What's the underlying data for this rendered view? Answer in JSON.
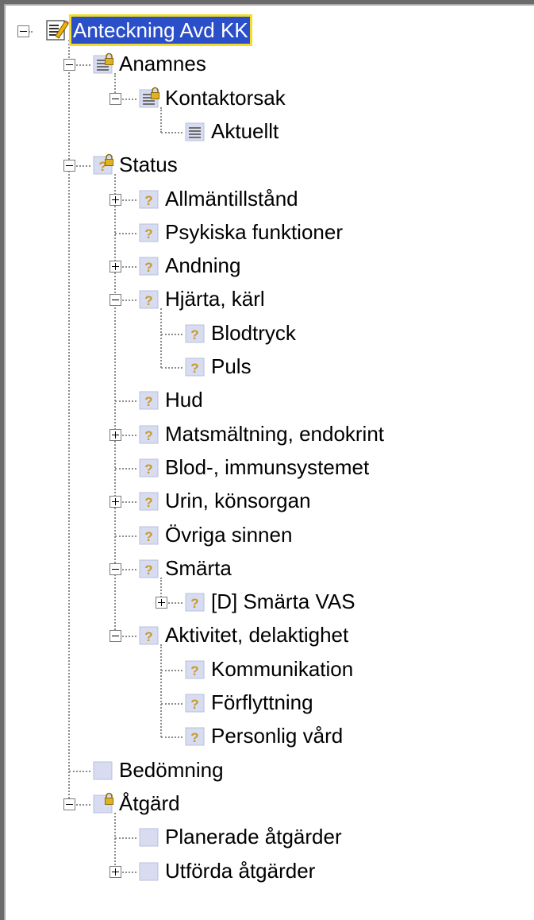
{
  "tree": {
    "nodes": [
      {
        "label": "Anteckning Avd KK",
        "icon": "note-pencil-icon",
        "depth": 0,
        "toggle": "minus",
        "selected": true
      },
      {
        "label": "Anamnes",
        "icon": "locked-document-icon",
        "depth": 1,
        "toggle": "minus"
      },
      {
        "label": "Kontaktorsak",
        "icon": "locked-document-icon",
        "depth": 2,
        "toggle": "minus"
      },
      {
        "label": "Aktuellt",
        "icon": "document-icon",
        "depth": 3,
        "toggle": "none"
      },
      {
        "label": "Status",
        "icon": "locked-question-icon",
        "depth": 1,
        "toggle": "minus"
      },
      {
        "label": "Allmäntillstånd",
        "icon": "question-icon",
        "depth": 2,
        "toggle": "plus"
      },
      {
        "label": "Psykiska funktioner",
        "icon": "question-icon",
        "depth": 2,
        "toggle": "none"
      },
      {
        "label": "Andning",
        "icon": "question-icon",
        "depth": 2,
        "toggle": "plus"
      },
      {
        "label": "Hjärta, kärl",
        "icon": "question-icon",
        "depth": 2,
        "toggle": "minus"
      },
      {
        "label": "Blodtryck",
        "icon": "question-icon",
        "depth": 3,
        "toggle": "none"
      },
      {
        "label": "Puls",
        "icon": "question-icon",
        "depth": 3,
        "toggle": "none"
      },
      {
        "label": "Hud",
        "icon": "question-icon",
        "depth": 2,
        "toggle": "none"
      },
      {
        "label": "Matsmältning, endokrint",
        "icon": "question-icon",
        "depth": 2,
        "toggle": "plus"
      },
      {
        "label": "Blod-, immunsystemet",
        "icon": "question-icon",
        "depth": 2,
        "toggle": "none"
      },
      {
        "label": "Urin, könsorgan",
        "icon": "question-icon",
        "depth": 2,
        "toggle": "plus"
      },
      {
        "label": "Övriga sinnen",
        "icon": "question-icon",
        "depth": 2,
        "toggle": "none"
      },
      {
        "label": "Smärta",
        "icon": "question-icon",
        "depth": 2,
        "toggle": "minus"
      },
      {
        "label": "[D] Smärta VAS",
        "icon": "question-icon",
        "depth": 3,
        "toggle": "plus"
      },
      {
        "label": "Aktivitet, delaktighet",
        "icon": "question-icon",
        "depth": 2,
        "toggle": "minus"
      },
      {
        "label": "Kommunikation",
        "icon": "question-icon",
        "depth": 3,
        "toggle": "none"
      },
      {
        "label": "Förflyttning",
        "icon": "question-icon",
        "depth": 3,
        "toggle": "none"
      },
      {
        "label": "Personlig vård",
        "icon": "question-icon",
        "depth": 3,
        "toggle": "none"
      },
      {
        "label": "Bedömning",
        "icon": "blank-node-icon",
        "depth": 1,
        "toggle": "none"
      },
      {
        "label": "Åtgärd",
        "icon": "locked-blank-icon",
        "depth": 1,
        "toggle": "minus"
      },
      {
        "label": "Planerade åtgärder",
        "icon": "blank-node-icon",
        "depth": 2,
        "toggle": "none"
      },
      {
        "label": "Utförda åtgärder",
        "icon": "blank-node-icon",
        "depth": 2,
        "toggle": "plus"
      }
    ]
  },
  "colors": {
    "selection_bg": "#2a4fc8",
    "selection_outline": "#f2de2a",
    "icon_fill": "#d7dcf0",
    "question_mark": "#c89a2a",
    "lock": "#e0b21e"
  }
}
